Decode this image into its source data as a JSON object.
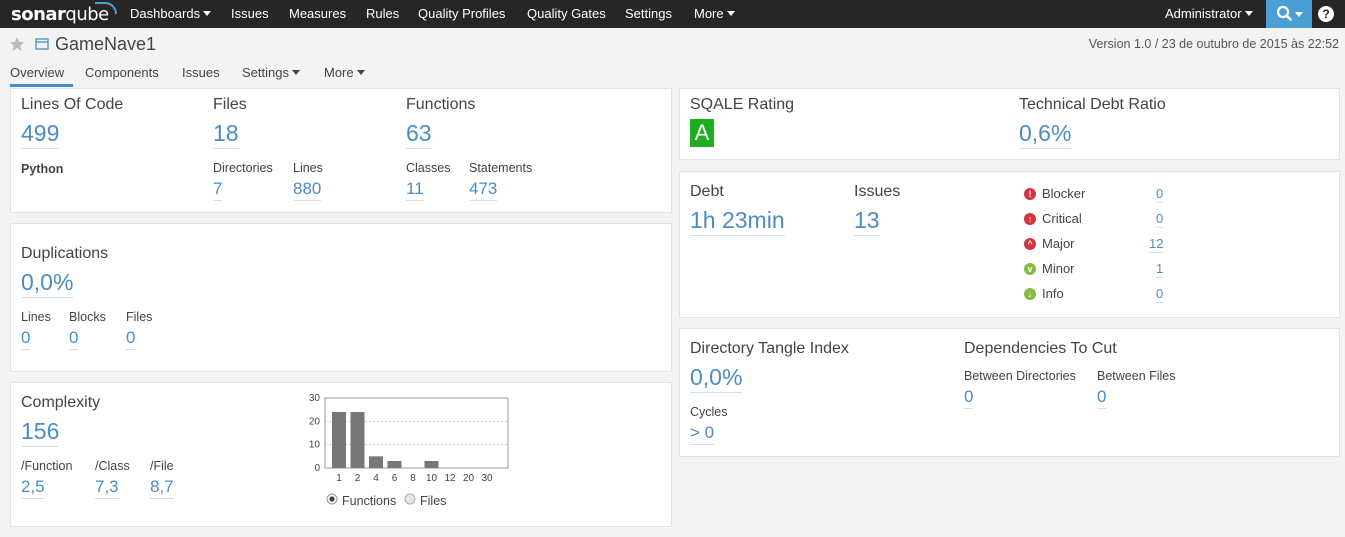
{
  "navbar": {
    "logo_bold": "sonar",
    "logo_light": "qube",
    "items": [
      "Dashboards",
      "Issues",
      "Measures",
      "Rules",
      "Quality Profiles",
      "Quality Gates",
      "Settings",
      "More"
    ],
    "user": "Administrator",
    "help": "?"
  },
  "project": {
    "name": "GameNave1",
    "version": "Version 1.0 / 23 de outubro de 2015 às 22:52"
  },
  "tabs": [
    "Overview",
    "Components",
    "Issues",
    "Settings",
    "More"
  ],
  "size": {
    "loc_label": "Lines Of Code",
    "loc_value": "499",
    "language": "Python",
    "files_label": "Files",
    "files_value": "18",
    "directories_label": "Directories",
    "directories_value": "7",
    "lines_label": "Lines",
    "lines_value": "880",
    "functions_label": "Functions",
    "functions_value": "63",
    "classes_label": "Classes",
    "classes_value": "11",
    "statements_label": "Statements",
    "statements_value": "473"
  },
  "duplications": {
    "title": "Duplications",
    "value": "0,0%",
    "lines_label": "Lines",
    "lines_value": "0",
    "blocks_label": "Blocks",
    "blocks_value": "0",
    "files_label": "Files",
    "files_value": "0"
  },
  "complexity": {
    "title": "Complexity",
    "value": "156",
    "per_function_label": "/Function",
    "per_function_value": "2,5",
    "per_class_label": "/Class",
    "per_class_value": "7,3",
    "per_file_label": "/File",
    "per_file_value": "8,7",
    "radio_functions": "Functions",
    "radio_files": "Files"
  },
  "chart_data": {
    "type": "bar",
    "categories": [
      "1",
      "2",
      "4",
      "6",
      "8",
      "10",
      "12",
      "20",
      "30"
    ],
    "values": [
      24,
      24,
      5,
      3,
      0,
      3,
      0,
      0,
      0
    ],
    "ylim": [
      0,
      30
    ],
    "yticks": [
      "30",
      "20",
      "10",
      "0"
    ],
    "grid": true,
    "bar_color": "#777777"
  },
  "sqale": {
    "rating_label": "SQALE Rating",
    "rating_value": "A",
    "rating_color": "#1fad20",
    "tdr_label": "Technical Debt Ratio",
    "tdr_value": "0,6%"
  },
  "debt": {
    "debt_label": "Debt",
    "debt_value": "1h 23min",
    "issues_label": "Issues",
    "issues_value": "13",
    "severities": [
      {
        "name": "Blocker",
        "count": "0",
        "icon": "blocker-icon",
        "color": "#d4333f",
        "glyph": "!"
      },
      {
        "name": "Critical",
        "count": "0",
        "icon": "critical-icon",
        "color": "#d4333f",
        "glyph": "↑"
      },
      {
        "name": "Major",
        "count": "12",
        "icon": "major-icon",
        "color": "#d4333f",
        "glyph": "^"
      },
      {
        "name": "Minor",
        "count": "1",
        "icon": "minor-icon",
        "color": "#87bb43",
        "glyph": "v"
      },
      {
        "name": "Info",
        "count": "0",
        "icon": "info-icon",
        "color": "#87bb43",
        "glyph": "↓"
      }
    ]
  },
  "tangle": {
    "title": "Directory Tangle Index",
    "value": "0,0%",
    "cycles_label": "Cycles",
    "cycles_value": "> 0",
    "deps_label": "Dependencies To Cut",
    "between_dirs_label": "Between Directories",
    "between_dirs_value": "0",
    "between_files_label": "Between Files",
    "between_files_value": "0"
  }
}
